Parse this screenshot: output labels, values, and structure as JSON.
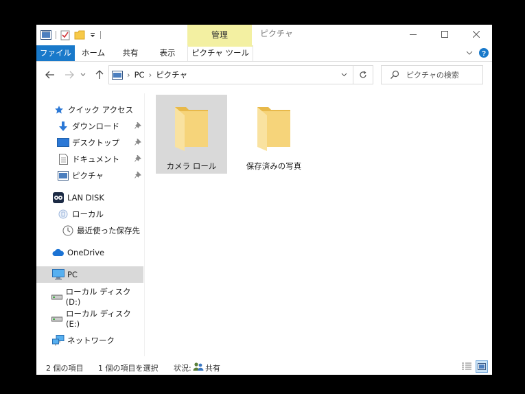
{
  "window": {
    "title": "ピクチャ",
    "contextual_tab_group": "管理",
    "controls": [
      "minimize-icon",
      "maximize-icon",
      "close-icon"
    ]
  },
  "ribbon": {
    "tabs": [
      "ファイル",
      "ホーム",
      "共有",
      "表示",
      "ピクチャ ツール"
    ],
    "file_color": "#1979ca",
    "contextual_color": "#f3f0a2"
  },
  "address": {
    "crumbs": [
      "PC",
      "ピクチャ"
    ]
  },
  "search": {
    "placeholder": "ピクチャの検索"
  },
  "nav": {
    "quick_access": "クイック アクセス",
    "pinned": [
      "ダウンロード",
      "デスクトップ",
      "ドキュメント",
      "ピクチャ"
    ],
    "lan_disk": "LAN DISK",
    "local": "ローカル",
    "recent": "最近使った保存先",
    "onedrive": "OneDrive",
    "pc": "PC",
    "drive_d": "ローカル ディスク (D:)",
    "drive_e": "ローカル ディスク (E:)",
    "network": "ネットワーク"
  },
  "folders": [
    {
      "name": "カメラ ロール",
      "selected": true
    },
    {
      "name": "保存済みの写真",
      "selected": false
    }
  ],
  "status": {
    "item_count": "2 個の項目",
    "selection": "1 個の項目を選択",
    "state_label": "状況:",
    "state_value": "共有"
  }
}
